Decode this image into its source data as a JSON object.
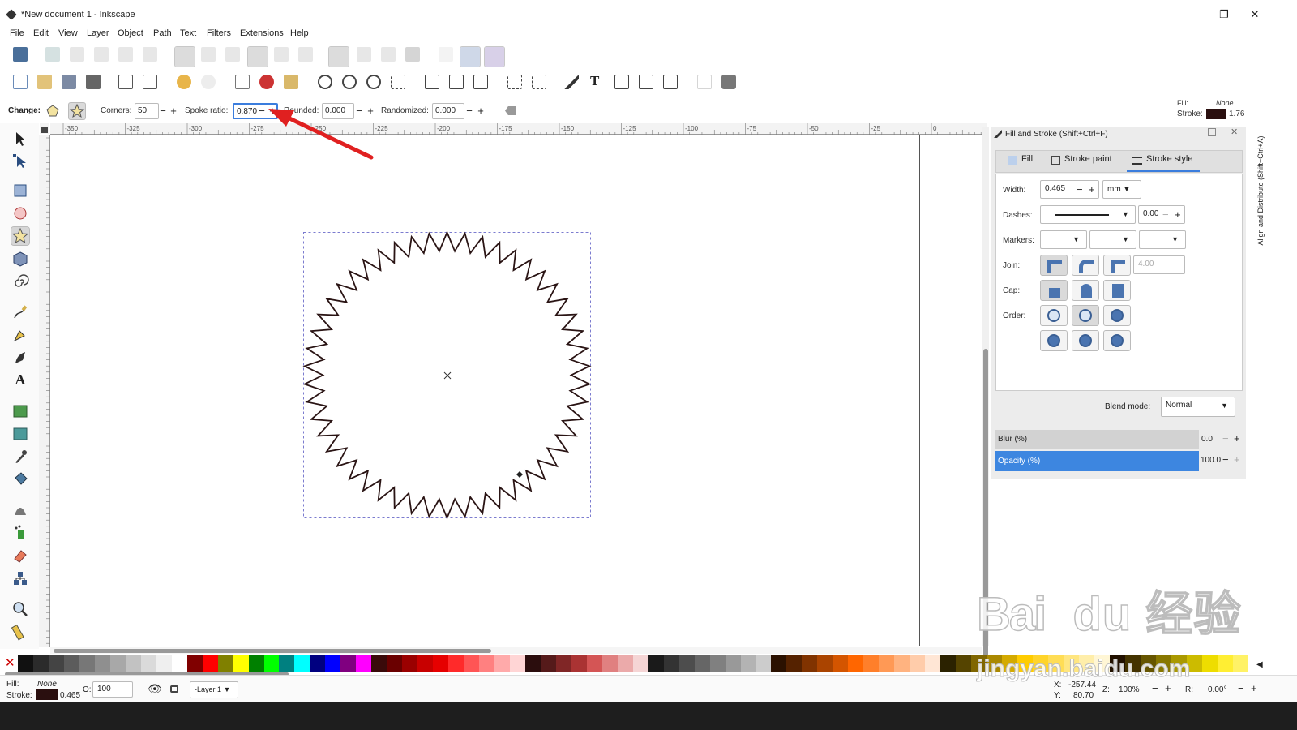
{
  "window": {
    "title": "*New document 1 - Inkscape",
    "minimize": "—",
    "maximize": "❐",
    "close": "✕"
  },
  "menu": [
    "File",
    "Edit",
    "View",
    "Layer",
    "Object",
    "Path",
    "Text",
    "Filters",
    "Extensions",
    "Help"
  ],
  "controls": {
    "change_label": "Change:",
    "corners_label": "Corners:",
    "corners_value": "50",
    "spoke_label": "Spoke ratio:",
    "spoke_value": "0.870",
    "rounded_label": "Rounded:",
    "rounded_value": "0.000",
    "randomized_label": "Randomized:",
    "randomized_value": "0.000",
    "minus": "−",
    "plus": "+"
  },
  "style_indicator": {
    "fill_label": "Fill:",
    "fill_value": "None",
    "stroke_label": "Stroke:",
    "stroke_width": "1.76",
    "stroke_color": "#2a0f0f"
  },
  "ruler_top": [
    "-350",
    "-325",
    "-300",
    "-275",
    "-250",
    "-225",
    "-200",
    "-175",
    "-150",
    "-125",
    "-100",
    "-75",
    "-50",
    "-25",
    "0"
  ],
  "fill_stroke": {
    "title": "Fill and Stroke (Shift+Ctrl+F)",
    "tabs": [
      "Fill",
      "Stroke paint",
      "Stroke style"
    ],
    "width_label": "Width:",
    "width_value": "0.465",
    "unit": "mm",
    "dashes_label": "Dashes:",
    "dash_offset": "0.00",
    "markers_label": "Markers:",
    "join_label": "Join:",
    "miter_value": "4.00",
    "cap_label": "Cap:",
    "order_label": "Order:",
    "blend_label": "Blend mode:",
    "blend_value": "Normal",
    "blur_label": "Blur (%)",
    "blur_value": "0.0",
    "opacity_label": "Opacity (%)",
    "opacity_value": "100.0"
  },
  "side_panel_label": "Align and Distribute (Shift+Ctrl+A)",
  "palette": [
    "#111111",
    "#2b2b2b",
    "#444444",
    "#5c5c5c",
    "#777777",
    "#8f8f8f",
    "#a8a8a8",
    "#c2c2c2",
    "#dadada",
    "#efefef",
    "#ffffff",
    "#800000",
    "#ff0000",
    "#808000",
    "#ffff00",
    "#008000",
    "#00ff00",
    "#008080",
    "#00ffff",
    "#000080",
    "#0000ff",
    "#800080",
    "#ff00ff",
    "#3a0a0a",
    "#6a0000",
    "#9a0000",
    "#c80000",
    "#e60000",
    "#ff2a2a",
    "#ff5555",
    "#ff8080",
    "#ffaaaa",
    "#ffd5d5",
    "#2b0d0d",
    "#551a1a",
    "#802626",
    "#aa3333",
    "#d45555",
    "#e08080",
    "#ebaaaa",
    "#f5d5d5",
    "#1a1a1a",
    "#333",
    "#4d4d4d",
    "#666",
    "#808080",
    "#999",
    "#b3b3b3",
    "#ccc",
    "#2b1100",
    "#552200",
    "#803300",
    "#aa4400",
    "#d45500",
    "#ff6600",
    "#ff7f2a",
    "#ff9955",
    "#ffb380",
    "#ffccaa",
    "#ffe6d5",
    "#2b2200",
    "#554400",
    "#806600",
    "#aa8800",
    "#d4aa00",
    "#ffcc00",
    "#ffd42a",
    "#ffdd55",
    "#ffe680",
    "#ffeeaa",
    "#fff6d5",
    "#221100",
    "#443300",
    "#665500",
    "#887700",
    "#aa9900",
    "#ccbb00",
    "#eedd00",
    "#ffee33",
    "#fff266"
  ],
  "status": {
    "fill_label": "Fill:",
    "fill_value": "None",
    "stroke_label": "Stroke:",
    "stroke_width": "0.465",
    "opacity_label": "O:",
    "opacity_value": "100",
    "layer": "-Layer 1",
    "x_label": "X:",
    "x_value": "-257.44",
    "y_label": "Y:",
    "y_value": "80.70",
    "zoom_label": "Z:",
    "zoom_value": "100%",
    "rotation_label": "R:",
    "rotation_value": "0.00°"
  },
  "star": {
    "corners": 50,
    "spoke_ratio": 0.87,
    "stroke": "#2a1414"
  },
  "watermark": {
    "logo": "Bai du 经验",
    "url": "jingyan.baidu.com"
  }
}
